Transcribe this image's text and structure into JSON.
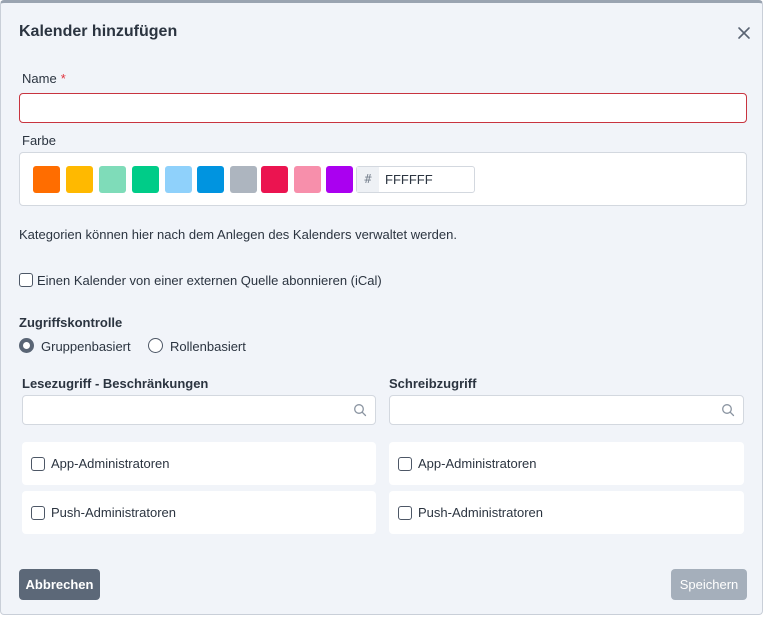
{
  "dialog": {
    "title": "Kalender hinzufügen",
    "close_icon": "close-icon"
  },
  "name": {
    "label": "Name",
    "required_mark": "*",
    "value": "",
    "border_color": "#c8343f"
  },
  "color": {
    "label": "Farbe",
    "swatches": [
      "#ff6d00",
      "#ffb900",
      "#7fdcb9",
      "#00cc88",
      "#8fd1fb",
      "#0094e0",
      "#adb5bf",
      "#eb1450",
      "#f78fab",
      "#aa00f0"
    ],
    "hash": "#",
    "hex_value": "FFFFFF"
  },
  "note": "Kategorien können hier nach dem Anlegen des Kalenders verwaltet werden.",
  "subscribe": {
    "label": "Einen Kalender von einer externen Quelle abonnieren (iCal)",
    "checked": false
  },
  "access": {
    "heading": "Zugriffskontrolle",
    "options": [
      {
        "label": "Gruppenbasiert",
        "selected": true
      },
      {
        "label": "Rollenbasiert",
        "selected": false
      }
    ]
  },
  "read": {
    "heading": "Lesezugriff - Beschränkungen",
    "search_value": "",
    "search_icon": "search-icon",
    "items": [
      {
        "label": "App-Administratoren",
        "checked": false
      },
      {
        "label": "Push-Administratoren",
        "checked": false
      }
    ]
  },
  "write": {
    "heading": "Schreibzugriff",
    "search_value": "",
    "search_icon": "search-icon",
    "items": [
      {
        "label": "App-Administratoren",
        "checked": false
      },
      {
        "label": "Push-Administratoren",
        "checked": false
      }
    ]
  },
  "buttons": {
    "cancel": "Abbrechen",
    "save": "Speichern"
  },
  "colors": {
    "background": "#f1f4f9",
    "primary_button": "#5c6878",
    "disabled_button": "#a5afbb"
  }
}
